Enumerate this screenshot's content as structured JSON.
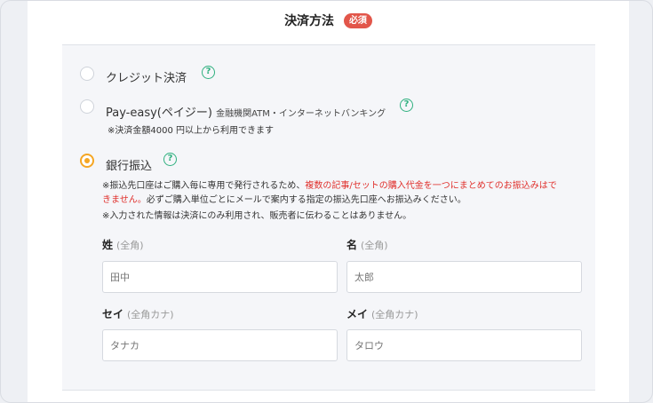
{
  "section": {
    "title": "決済方法",
    "required_badge": "必須"
  },
  "options": [
    {
      "label": "クレジット決済",
      "selected": false
    },
    {
      "label": "Pay-easy(ペイジー)",
      "label_small": "金融機関ATM・インターネットバンキング",
      "note": "※決済金額4000 円以上から利用できます",
      "selected": false
    },
    {
      "label": "銀行振込",
      "selected": true
    }
  ],
  "bank_notes": {
    "line1_prefix": "※振込先口座はご購入毎に専用で発行されるため、",
    "line1_red": "複数の記事/セットの購入代金を一つにまとめてのお振込みはで",
    "line2_red": "きません。",
    "line2_rest": "必ずご購入単位ごとにメールで案内する指定の振込先口座へお振込みください。",
    "line3": "※入力された情報は決済にのみ利用され、販売者に伝わることはありません。"
  },
  "fields": {
    "sei": {
      "label": "姓",
      "sub": "(全角)",
      "placeholder": "田中"
    },
    "mei": {
      "label": "名",
      "sub": "(全角)",
      "placeholder": "太郎"
    },
    "sei_kana": {
      "label": "セイ",
      "sub": "(全角カナ)",
      "placeholder": "タナカ"
    },
    "mei_kana": {
      "label": "メイ",
      "sub": "(全角カナ)",
      "placeholder": "タロウ"
    }
  },
  "icons": {
    "help": "question-bubble-icon"
  },
  "colors": {
    "accent": "#f5a623",
    "badge": "#e2564a",
    "help": "#2fb07f",
    "warning": "#e0302c"
  }
}
